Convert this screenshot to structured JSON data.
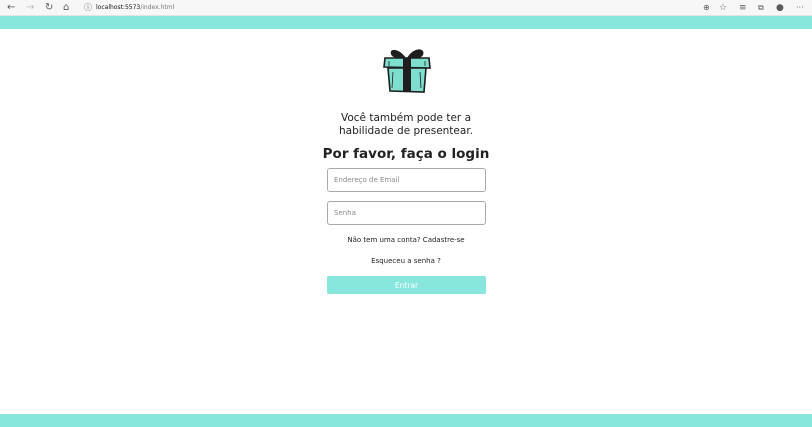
{
  "browser": {
    "url_host": "localhost:5573",
    "url_path": "/index.html",
    "more_label": "···"
  },
  "colors": {
    "accent": "#87e7dd",
    "gift_body": "#7edfcf",
    "text": "#222222"
  },
  "icons": [
    "back-icon",
    "forward-icon",
    "refresh-icon",
    "home-icon",
    "info-icon",
    "zoom-icon",
    "favorite-icon",
    "favorites-list-icon",
    "collections-icon",
    "profile-icon",
    "more-icon",
    "gift-logo"
  ],
  "login": {
    "tagline_line1": "Você também pode ter a",
    "tagline_line2": "habilidade de presentear.",
    "title": "Por favor, faça o login",
    "email_placeholder": "Endereço de Email",
    "password_placeholder": "Senha",
    "signup_link": "Não tem uma conta? Cadastre-se",
    "forgot_link": "Esqueceu a senha ?",
    "submit_label": "Entrar"
  }
}
